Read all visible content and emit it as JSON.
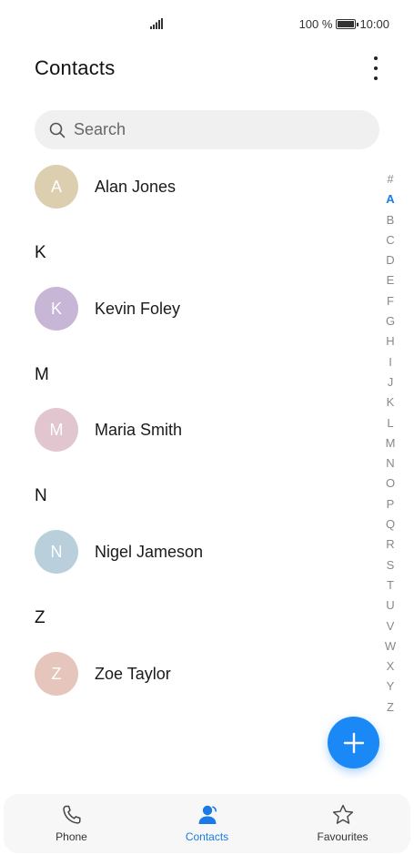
{
  "status_bar": {
    "battery_text": "100 %",
    "time": "10:00"
  },
  "header": {
    "title": "Contacts"
  },
  "search": {
    "placeholder": "Search"
  },
  "sections": [
    {
      "header": "",
      "contacts": [
        {
          "initial": "A",
          "name": "Alan Jones",
          "color": "#dccfb0"
        }
      ]
    },
    {
      "header": "K",
      "contacts": [
        {
          "initial": "K",
          "name": "Kevin Foley",
          "color": "#c7b6d6"
        }
      ]
    },
    {
      "header": "M",
      "contacts": [
        {
          "initial": "M",
          "name": "Maria Smith",
          "color": "#e2c6cf"
        }
      ]
    },
    {
      "header": "N",
      "contacts": [
        {
          "initial": "N",
          "name": "Nigel Jameson",
          "color": "#b9cfdc"
        }
      ]
    },
    {
      "header": "Z",
      "contacts": [
        {
          "initial": "Z",
          "name": "Zoe Taylor",
          "color": "#e6c6bc"
        }
      ]
    }
  ],
  "alpha_index": [
    "#",
    "A",
    "B",
    "C",
    "D",
    "E",
    "F",
    "G",
    "H",
    "I",
    "J",
    "K",
    "L",
    "M",
    "N",
    "O",
    "P",
    "Q",
    "R",
    "S",
    "T",
    "U",
    "V",
    "W",
    "X",
    "Y",
    "Z"
  ],
  "alpha_active": "A",
  "bottom_nav": [
    {
      "label": "Phone",
      "icon": "phone-icon",
      "active": false
    },
    {
      "label": "Contacts",
      "icon": "contacts-icon",
      "active": true
    },
    {
      "label": "Favourites",
      "icon": "star-icon",
      "active": false
    }
  ],
  "accent_color": "#1a7be5"
}
